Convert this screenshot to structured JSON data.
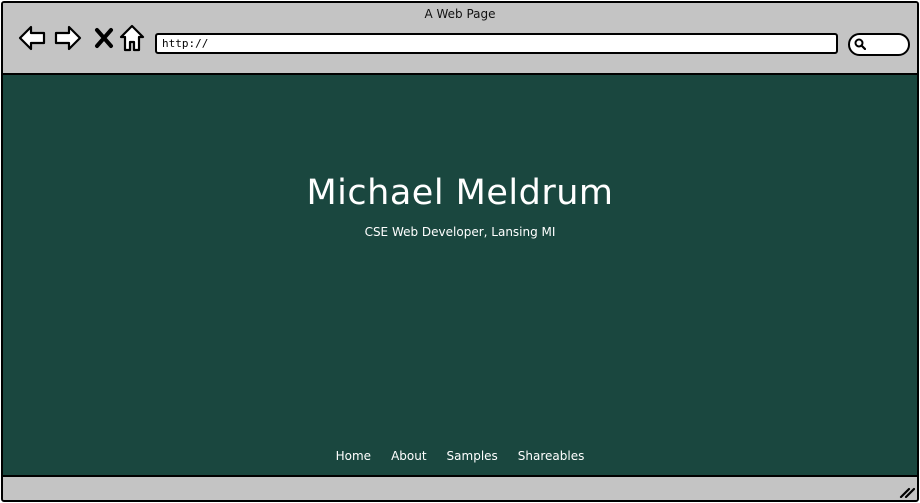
{
  "window": {
    "title": "A Web Page"
  },
  "toolbar": {
    "back_icon": "arrow-left-icon",
    "forward_icon": "arrow-right-icon",
    "stop_icon": "close-icon",
    "home_icon": "home-icon",
    "search_icon": "search-icon"
  },
  "address_bar": {
    "value": "http://"
  },
  "page": {
    "background_color": "#1a473f",
    "name": "Michael Meldrum",
    "tagline": "CSE Web Developer, Lansing MI",
    "nav": [
      {
        "label": "Home"
      },
      {
        "label": "About"
      },
      {
        "label": "Samples"
      },
      {
        "label": "Shareables"
      }
    ]
  }
}
